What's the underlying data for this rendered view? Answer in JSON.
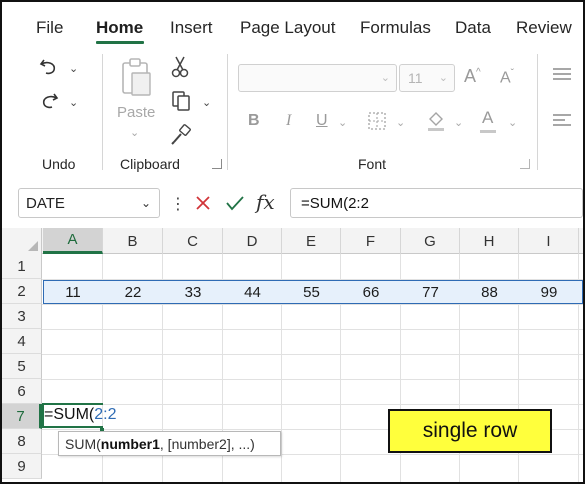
{
  "ribbon_tabs": [
    "File",
    "Home",
    "Insert",
    "Page Layout",
    "Formulas",
    "Data",
    "Review"
  ],
  "ribbon": {
    "undo_group_label": "Undo",
    "clipboard_group_label": "Clipboard",
    "font_group_label": "Font",
    "paste_label": "Paste",
    "font_size_value": "11",
    "bold_label": "B",
    "italic_label": "I",
    "underline_label": "U",
    "font_color_label": "A"
  },
  "formula_bar": {
    "name_box_value": "DATE",
    "fx_label": "fx",
    "formula_value": "=SUM(2:2"
  },
  "grid": {
    "columns": [
      "A",
      "B",
      "C",
      "D",
      "E",
      "F",
      "G",
      "H",
      "I"
    ],
    "rows": [
      "1",
      "2",
      "3",
      "4",
      "5",
      "6",
      "7",
      "8",
      "9"
    ],
    "row2_values": [
      "11",
      "22",
      "33",
      "44",
      "55",
      "66",
      "77",
      "88",
      "99"
    ],
    "edit_cell": {
      "prefix": "=SUM(",
      "ref": "2:2"
    },
    "tooltip": {
      "fn": "SUM(",
      "arg1": "number1",
      "rest": ", [number2], ...)"
    }
  },
  "annotation": "single row",
  "colors": {
    "accent_green": "#217346",
    "ref_blue": "#2e6bb4",
    "row_highlight": "#e6f0fb",
    "badge_yellow": "#ffff3c",
    "cancel_red": "#d13438"
  },
  "icons": [
    "undo-icon",
    "redo-icon",
    "cut-icon",
    "copy-icon",
    "paste-icon",
    "format-painter-icon",
    "grow-font-icon",
    "shrink-font-icon",
    "fill-color-icon",
    "font-color-icon",
    "align-icon",
    "cancel-icon",
    "enter-icon",
    "function-icon"
  ]
}
